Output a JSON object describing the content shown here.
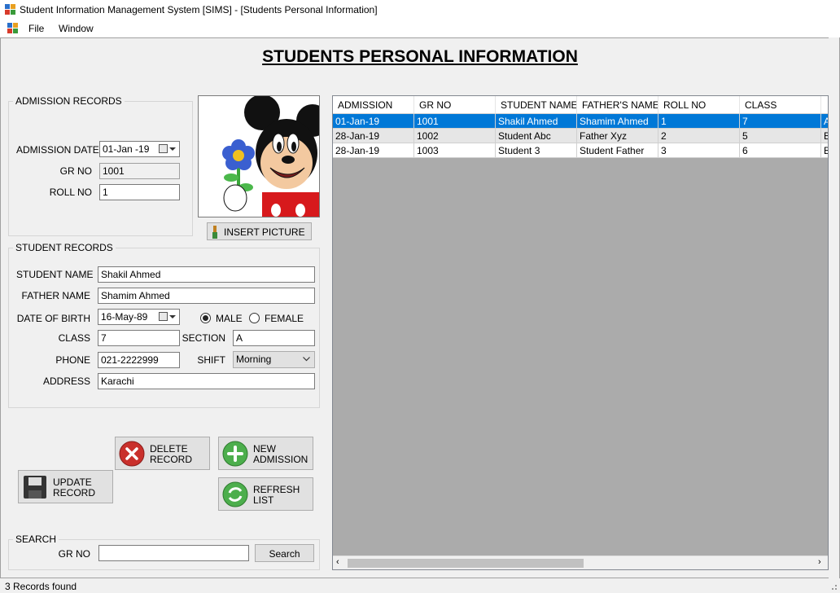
{
  "window": {
    "title": "Student Information Management System [SIMS] - [Students Personal Information]"
  },
  "menu": {
    "file": "File",
    "window": "Window"
  },
  "heading": "STUDENTS PERSONAL INFORMATION",
  "admission": {
    "group_label": "ADMISSION RECORDS",
    "date_label": "ADMISSION DATE",
    "date_value": "01-Jan -19",
    "gr_label": "GR NO",
    "gr_value": "1001",
    "roll_label": "ROLL NO",
    "roll_value": "1"
  },
  "picture": {
    "insert_label": "INSERT PICTURE"
  },
  "student": {
    "group_label": "STUDENT RECORDS",
    "name_label": "STUDENT NAME",
    "name_value": "Shakil Ahmed",
    "father_label": "FATHER NAME",
    "father_value": "Shamim Ahmed",
    "dob_label": "DATE OF BIRTH",
    "dob_value": "16-May-89",
    "male_label": "MALE",
    "female_label": "FEMALE",
    "gender": "MALE",
    "class_label": "CLASS",
    "class_value": "7",
    "section_label": "SECTION",
    "section_value": "A",
    "phone_label": "PHONE",
    "phone_value": "021-2222999",
    "shift_label": "SHIFT",
    "shift_value": "Morning",
    "address_label": "ADDRESS",
    "address_value": "Karachi"
  },
  "buttons": {
    "delete": "DELETE\nRECORD",
    "new": "NEW\nADMISSION",
    "update": "UPDATE\nRECORD",
    "refresh": "REFRESH\nLIST"
  },
  "search": {
    "group_label": "SEARCH",
    "gr_label": "GR NO",
    "value": "",
    "button": "Search"
  },
  "grid": {
    "columns": [
      "ADMISSION",
      "GR NO",
      "STUDENT NAME",
      "FATHER'S NAME",
      "ROLL NO",
      "CLASS",
      ""
    ],
    "rows": [
      [
        "01-Jan-19",
        "1001",
        "Shakil Ahmed",
        "Shamim Ahmed",
        "1",
        "7",
        "A"
      ],
      [
        "28-Jan-19",
        "1002",
        "Student Abc",
        "Father Xyz",
        "2",
        "5",
        "B"
      ],
      [
        "28-Jan-19",
        "1003",
        "Student 3",
        "Student Father",
        "3",
        "6",
        "B"
      ]
    ],
    "selected_row": 0
  },
  "status": "3 Records found",
  "colors": {
    "selection": "#0078d7",
    "grid_bg": "#ababab"
  }
}
